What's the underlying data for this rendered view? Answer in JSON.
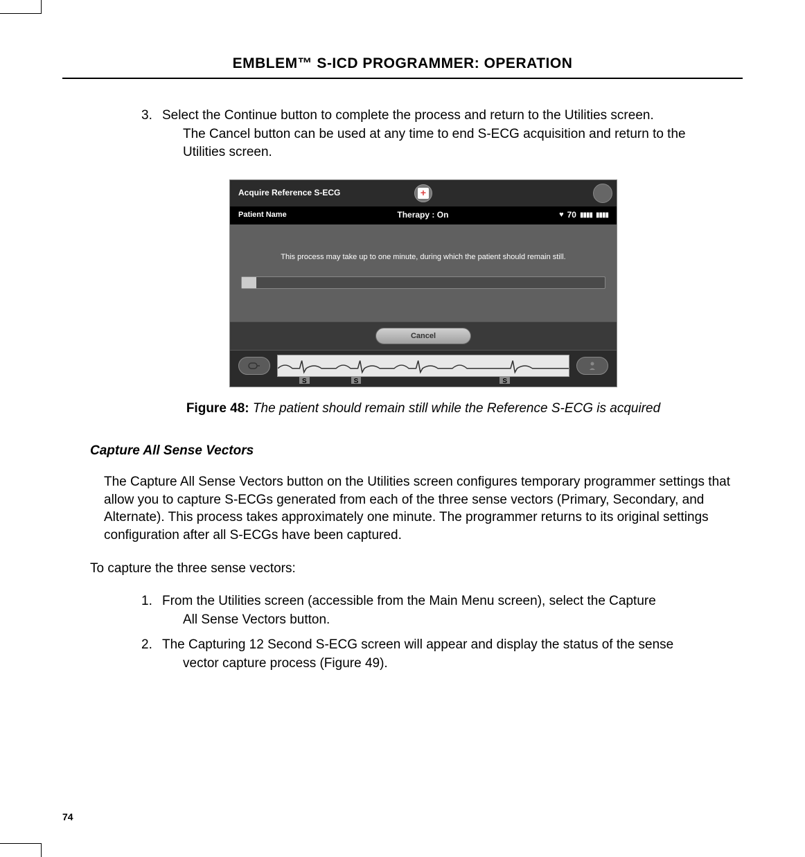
{
  "header": {
    "title": "EMBLEM™ S-ICD PROGRAMMER: OPERATION"
  },
  "step3": {
    "number": "3.",
    "line1": "Select the Continue button to complete the process and return to the Utilities screen.",
    "line2": "The Cancel button can be used at any time to end S-ECG acquisition and return to the",
    "line3": "Utilities screen."
  },
  "device": {
    "topbar_title": "Acquire Reference S-ECG",
    "plus_glyph": "+",
    "patient_name_label": "Patient Name",
    "therapy_label": "Therapy :",
    "therapy_value": "On",
    "heart_glyph": "♥",
    "bpm": "70",
    "process_message": "This process may take up to one minute, during which the patient should remain still.",
    "cancel_label": "Cancel",
    "marker": "S"
  },
  "figure": {
    "label": "Figure 48:",
    "caption": "The patient should remain still while the Reference S-ECG is acquired"
  },
  "section": {
    "heading": "Capture All Sense Vectors",
    "para": "The Capture All Sense Vectors button on the Utilities screen configures temporary programmer settings that allow you to capture S-ECGs generated from each of the three sense vectors (Primary, Secondary, and Alternate). This process takes approximately one minute. The programmer returns to its original settings configuration after all S-ECGs have been captured.",
    "intro": "To capture the three sense vectors:",
    "steps": [
      {
        "num": "1.",
        "line1": "From the Utilities screen (accessible from the Main Menu screen), select the Capture",
        "line2": "All Sense Vectors button."
      },
      {
        "num": "2.",
        "line1": "The Capturing 12 Second S-ECG screen will appear and display the status of the sense",
        "line2": "vector capture process (Figure 49)."
      }
    ]
  },
  "page_number": "74"
}
